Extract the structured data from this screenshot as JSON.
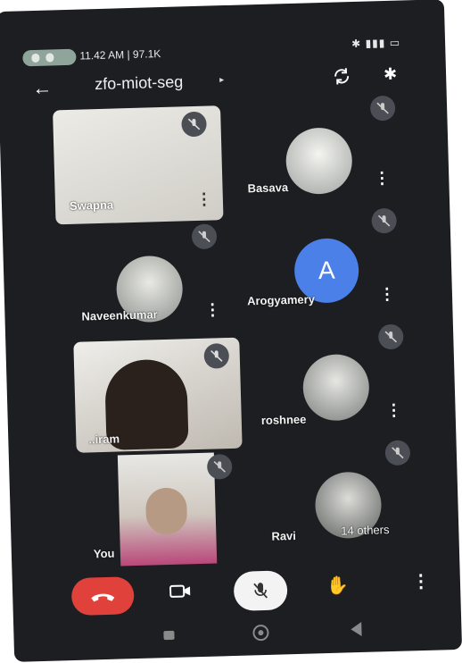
{
  "status_bar": {
    "time_text": "11.42 AM | 97.1K",
    "right_icons": [
      "bluetooth-icon",
      "battery-icon",
      "signal-icon"
    ]
  },
  "header": {
    "back_icon": "arrow-left-icon",
    "title": "zfo-miot-seg",
    "title_caret": "▸",
    "switch_camera_icon": "camera-flip-icon",
    "bluetooth_audio_icon": "bluetooth-icon"
  },
  "participants": [
    {
      "name": "Swapna",
      "muted": true,
      "has_video": true
    },
    {
      "name": "Basava",
      "muted": true,
      "has_photo": true
    },
    {
      "name": "Naveenkumar",
      "muted": true,
      "has_photo": true
    },
    {
      "name": "Arogyamery",
      "muted": true,
      "avatar_letter": "A"
    },
    {
      "name": "..iram",
      "muted": true,
      "has_video": true
    },
    {
      "name": "roshnee",
      "muted": true,
      "has_photo": true
    },
    {
      "name": "You",
      "muted": true,
      "has_video": true
    },
    {
      "name": "Ravi",
      "others_label": "14 others",
      "muted": true
    }
  ],
  "controls": {
    "end_call_icon": "phone-hangup-icon",
    "camera_icon": "video-camera-icon",
    "mic_icon": "mic-off-icon",
    "raise_hand_icon": "hand-icon",
    "more_icon": "more-vert-icon"
  },
  "colors": {
    "end_call": "#e0413b",
    "avatar_blue": "#4a80e8",
    "mute_badge": "#4b4e55",
    "background": "#1d1e22"
  }
}
